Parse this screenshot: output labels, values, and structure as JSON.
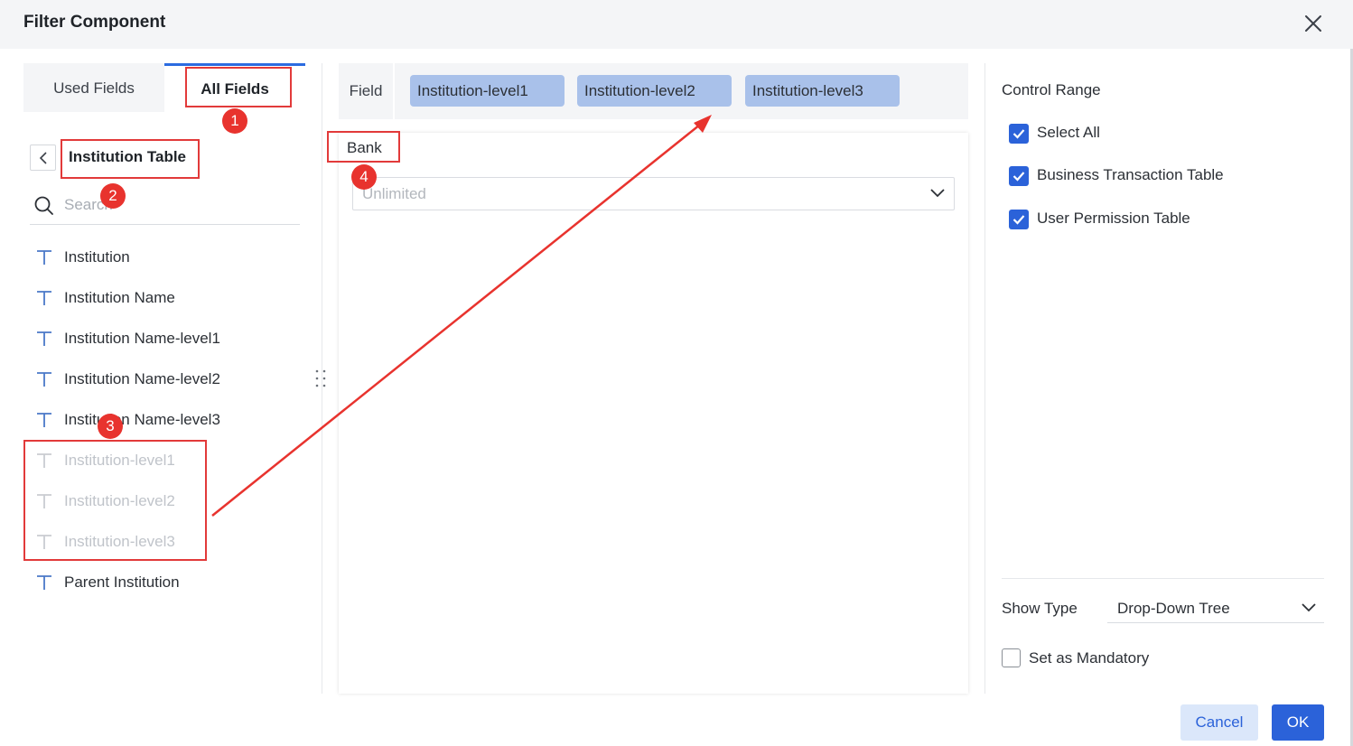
{
  "dialog": {
    "title": "Filter Component"
  },
  "icons": {
    "close": "close-icon",
    "back": "chevron-left-icon",
    "search": "search-icon",
    "text_field": "text-type-icon",
    "chevron": "chevron-down-icon",
    "check": "check-icon",
    "drag": "drag-handle-icon"
  },
  "colors": {
    "accent": "#2b62d9",
    "chip": "#a9c1ea",
    "annotation": "#e23a3a"
  },
  "left_panel": {
    "tabs": [
      {
        "label": "Used Fields",
        "active": false
      },
      {
        "label": "All Fields",
        "active": true
      }
    ],
    "table_name": "Institution Table",
    "search_placeholder": "Search",
    "fields": [
      {
        "label": "Institution",
        "disabled": false
      },
      {
        "label": "Institution Name",
        "disabled": false
      },
      {
        "label": "Institution Name-level1",
        "disabled": false
      },
      {
        "label": "Institution Name-level2",
        "disabled": false
      },
      {
        "label": "Institution Name-level3",
        "disabled": false
      },
      {
        "label": "Institution-level1",
        "disabled": true
      },
      {
        "label": "Institution-level2",
        "disabled": true
      },
      {
        "label": "Institution-level3",
        "disabled": true
      },
      {
        "label": "Parent Institution",
        "disabled": false
      }
    ]
  },
  "middle_panel": {
    "field_label": "Field",
    "chips": [
      "Institution-level1",
      "Institution-level2",
      "Institution-level3"
    ],
    "section_label": "Bank",
    "range_value": "Unlimited"
  },
  "right_panel": {
    "control_range_label": "Control Range",
    "checkboxes": [
      {
        "label": "Select All",
        "checked": true
      },
      {
        "label": "Business Transaction Table",
        "checked": true
      },
      {
        "label": "User Permission Table",
        "checked": true
      }
    ],
    "show_type_label": "Show Type",
    "show_type_value": "Drop-Down Tree",
    "mandatory_label": "Set as Mandatory",
    "mandatory_checked": false
  },
  "footer": {
    "cancel_label": "Cancel",
    "ok_label": "OK"
  },
  "annotations": {
    "badges": [
      "1",
      "2",
      "3",
      "4"
    ]
  }
}
